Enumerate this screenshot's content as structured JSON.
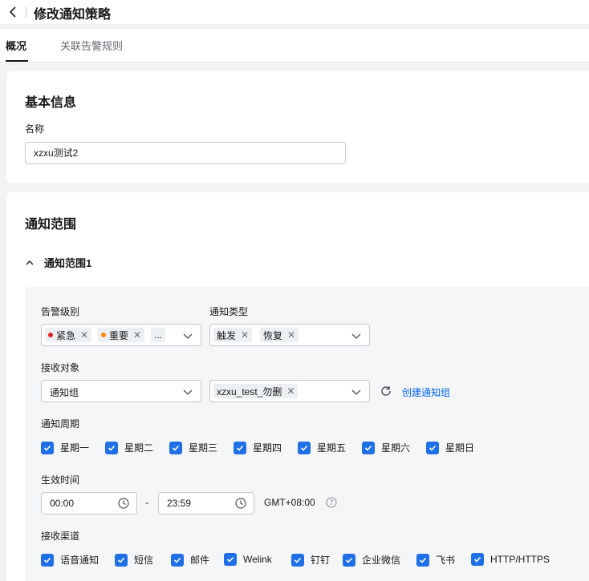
{
  "header": {
    "title": "修改通知策略"
  },
  "tabs": [
    {
      "label": "概况",
      "active": true
    },
    {
      "label": "关联告警规则",
      "active": false
    }
  ],
  "basic": {
    "title": "基本信息",
    "name_label": "名称",
    "name_value": "xzxu测试2"
  },
  "scope": {
    "title": "通知范围",
    "group_title": "通知范围1",
    "alarm_level": {
      "label": "告警级别",
      "tags": [
        {
          "text": "紧急",
          "color": "#e02020"
        },
        {
          "text": "重要",
          "color": "#ff8a00"
        }
      ],
      "more": "..."
    },
    "notify_type": {
      "label": "通知类型",
      "tags": [
        "触发",
        "恢复"
      ]
    },
    "receiver": {
      "label": "接收对象",
      "type_value": "通知组",
      "group_tag": "xzxu_test_勿删",
      "create_link": "创建通知组"
    },
    "period": {
      "label": "通知周期",
      "days": [
        "星期一",
        "星期二",
        "星期三",
        "星期四",
        "星期五",
        "星期六",
        "星期日"
      ]
    },
    "effective": {
      "label": "生效时间",
      "start": "00:00",
      "end": "23:59",
      "separator": "-",
      "timezone": "GMT+08:00"
    },
    "channels": {
      "label": "接收渠道",
      "items": [
        "语音通知",
        "短信",
        "邮件",
        "Welink",
        "钉钉",
        "企业微信",
        "飞书",
        "HTTP/HTTPS"
      ]
    }
  },
  "colors": {
    "accent": "#1f6fe6",
    "link": "#0064ff",
    "critical": "#e02020",
    "major": "#ff8a00"
  }
}
